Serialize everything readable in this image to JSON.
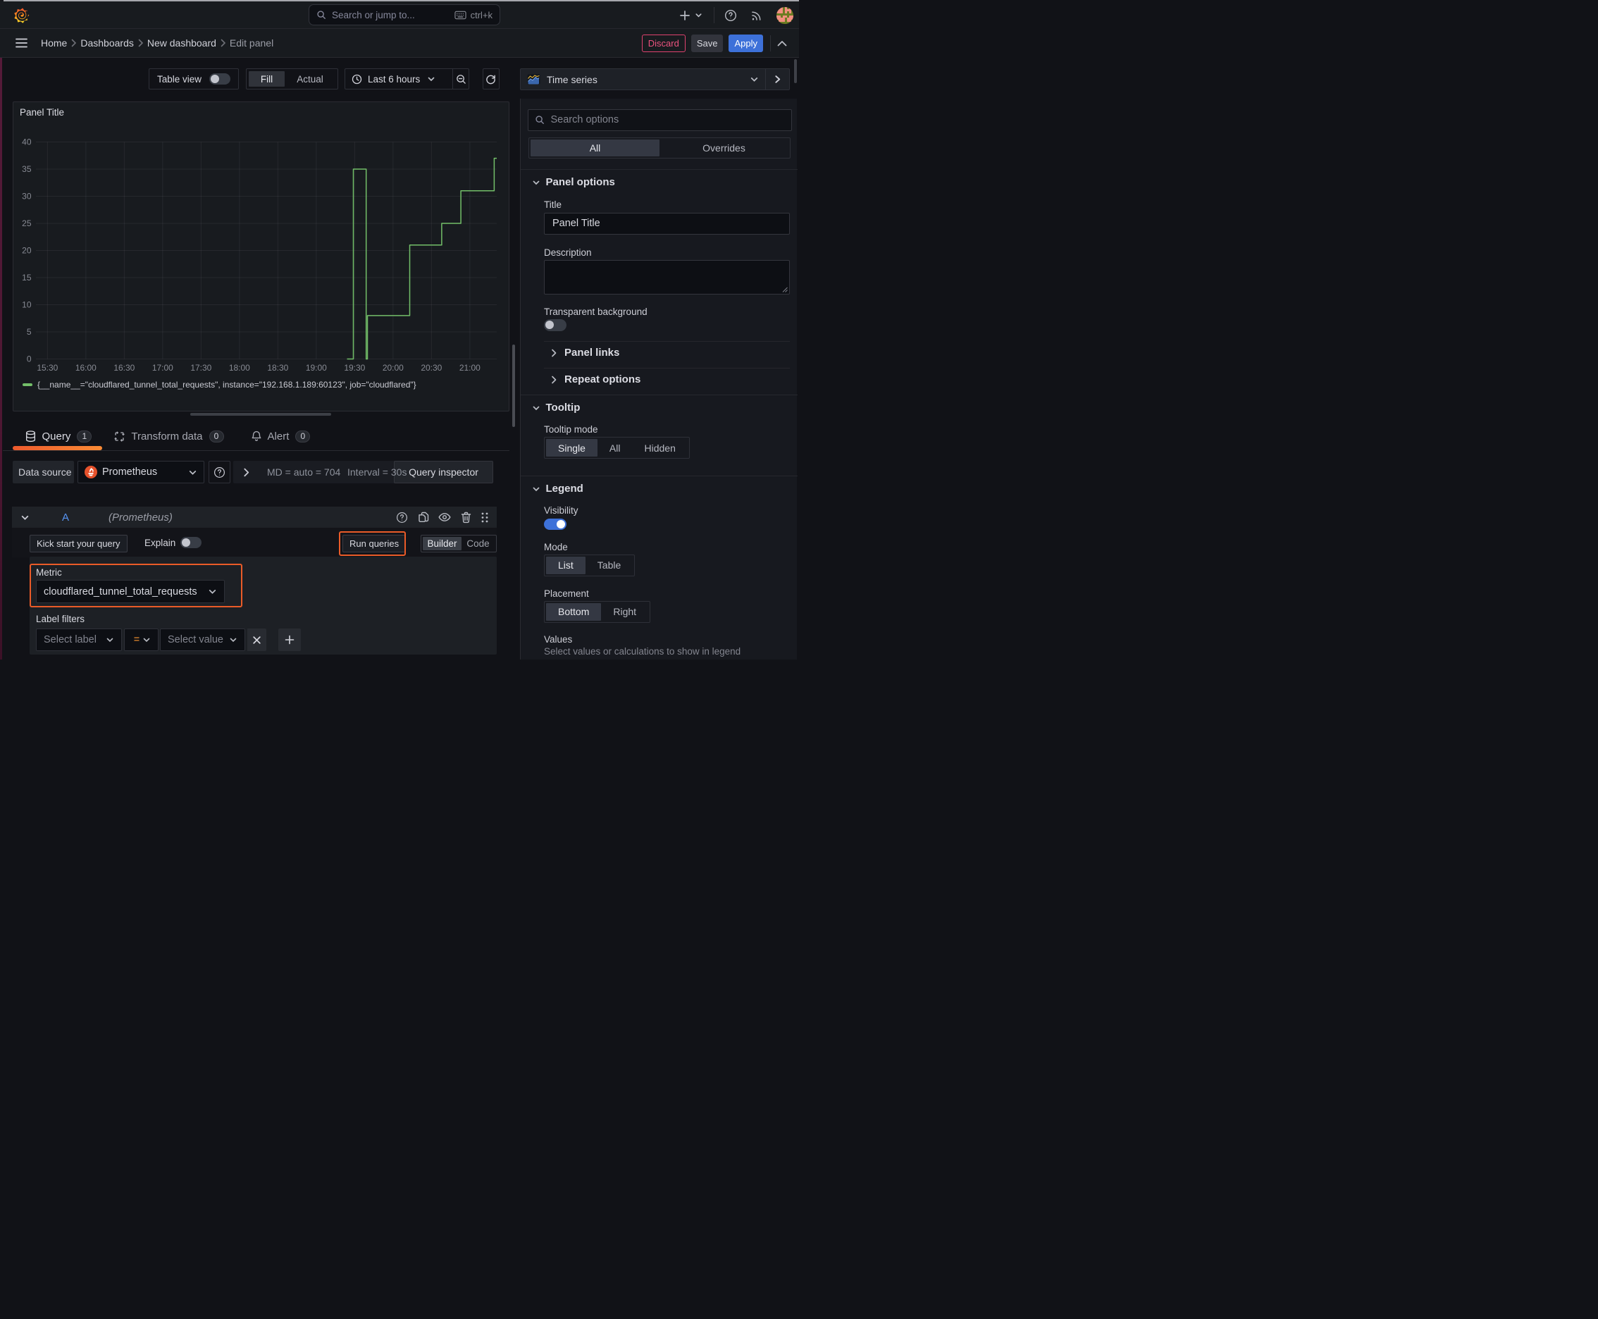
{
  "topnav": {
    "search_placeholder": "Search or jump to...",
    "shortcut": "ctrl+k"
  },
  "breadcrumbs": {
    "items": [
      {
        "label": "Home"
      },
      {
        "label": "Dashboards"
      },
      {
        "label": "New dashboard"
      },
      {
        "label": "Edit panel"
      }
    ]
  },
  "actions": {
    "discard": "Discard",
    "save": "Save",
    "apply": "Apply"
  },
  "toolbar": {
    "table_view_label": "Table view",
    "fill_label": "Fill",
    "actual_label": "Actual",
    "time_range_label": "Last 6 hours"
  },
  "viz_picker": {
    "name": "Time series"
  },
  "panel": {
    "title": "Panel Title"
  },
  "chart_data": {
    "type": "line",
    "line_interpolation": "step-after",
    "title": "Panel Title",
    "x_ticks": [
      "15:30",
      "16:00",
      "16:30",
      "17:00",
      "17:30",
      "18:00",
      "18:30",
      "19:00",
      "19:30",
      "20:00",
      "20:30",
      "21:00"
    ],
    "x_domain": [
      "15:21",
      "21:21"
    ],
    "y_ticks": [
      0,
      5,
      10,
      15,
      20,
      25,
      30,
      35,
      40
    ],
    "ylim": [
      0,
      40
    ],
    "grid": true,
    "legend_position": "bottom",
    "series": [
      {
        "name": "{__name__=\"cloudflared_tunnel_total_requests\", instance=\"192.168.1.189:60123\", job=\"cloudflared\"}",
        "color": "#73bf69",
        "points": [
          [
            "19:24",
            0
          ],
          [
            "19:29",
            35
          ],
          [
            "19:39",
            0
          ],
          [
            "19:40",
            8
          ],
          [
            "20:13",
            21
          ],
          [
            "20:38",
            25
          ],
          [
            "20:53",
            31
          ],
          [
            "21:19",
            37
          ],
          [
            "21:21",
            37
          ]
        ]
      }
    ]
  },
  "query_tabs": {
    "query": {
      "label": "Query",
      "count": "1"
    },
    "transform": {
      "label": "Transform data",
      "count": "0"
    },
    "alert": {
      "label": "Alert",
      "count": "0"
    }
  },
  "query_editor": {
    "datasource_label": "Data source",
    "datasource_value": "Prometheus",
    "md_text": "MD = auto = 704",
    "interval_text": "Interval = 30s",
    "inspector_label": "Query inspector",
    "ref_id": "A",
    "ref_ds": "(Prometheus)",
    "kick_start": "Kick start your query",
    "explain_label": "Explain",
    "run_queries": "Run queries",
    "builder_label": "Builder",
    "code_label": "Code",
    "metric_label": "Metric",
    "metric_value": "cloudflared_tunnel_total_requests",
    "label_filters_label": "Label filters",
    "select_label_placeholder": "Select label",
    "operator_value": "=",
    "select_value_placeholder": "Select value"
  },
  "options_pane": {
    "search_placeholder": "Search options",
    "tab_all": "All",
    "tab_overrides": "Overrides",
    "panel_options": {
      "heading": "Panel options",
      "title_label": "Title",
      "title_value": "Panel Title",
      "description_label": "Description",
      "transparent_label": "Transparent background",
      "panel_links": "Panel links",
      "repeat_options": "Repeat options"
    },
    "tooltip": {
      "heading": "Tooltip",
      "mode_label": "Tooltip mode",
      "modes": [
        {
          "label": "Single"
        },
        {
          "label": "All"
        },
        {
          "label": "Hidden"
        }
      ]
    },
    "legend": {
      "heading": "Legend",
      "visibility_label": "Visibility",
      "mode_label": "Mode",
      "modes": [
        {
          "label": "List"
        },
        {
          "label": "Table"
        }
      ],
      "placement_label": "Placement",
      "placements": [
        {
          "label": "Bottom"
        },
        {
          "label": "Right"
        }
      ],
      "values_label": "Values",
      "values_placeholder": "Select values or calculations to show in legend"
    }
  },
  "colors": {
    "accent_blue": "#3d71d9",
    "series_green": "#73bf69",
    "annotation_orange": "#ea5b28",
    "discard_pink": "#e0426f",
    "operator_orange": "#ff9830"
  }
}
